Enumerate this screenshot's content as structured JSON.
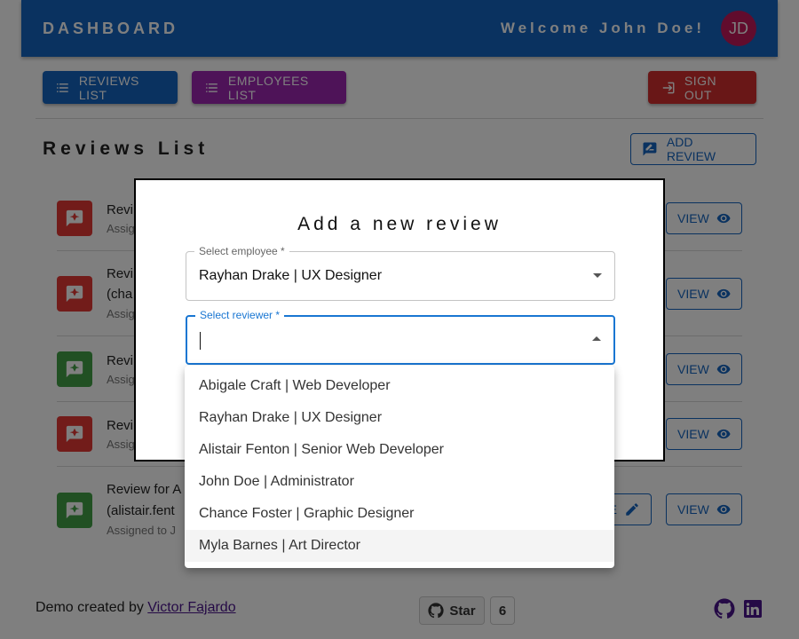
{
  "header": {
    "brand": "DASHBOARD",
    "welcome": "Welcome John Doe!",
    "avatar_initials": "JD"
  },
  "nav": {
    "reviews_list": "REVIEWS LIST",
    "employees_list": "EMPLOYEES LIST",
    "sign_out": "SIGN OUT"
  },
  "reviews": {
    "title": "Reviews List",
    "add_label": "ADD REVIEW",
    "rows": [
      {
        "title": "Revi",
        "subtitle": "Assig",
        "status_color": "#e53935",
        "view_label": "VIEW"
      },
      {
        "title": "Revi",
        "title_line2": "(cha",
        "subtitle": "Assig",
        "status_color": "#e53935",
        "view_label": "VIEW"
      },
      {
        "title": "Revi",
        "subtitle": "Assig",
        "status_color": "#43a047",
        "view_label": "VIEW"
      },
      {
        "title": "Revi",
        "subtitle": "Assig",
        "status_color": "#e53935",
        "view_label": "VIEW"
      },
      {
        "title": "Review for A",
        "title_line2": "(alistair.fent",
        "subtitle": "Assigned to J",
        "status_color": "#43a047",
        "edit_label": "E",
        "view_label": "VIEW"
      }
    ]
  },
  "modal": {
    "title": "Add a new review",
    "employee_field": {
      "label": "Select employee *",
      "value": "Rayhan Drake | UX Designer"
    },
    "reviewer_field": {
      "label": "Select reviewer *",
      "value": ""
    },
    "options": [
      "Abigale Craft | Web Developer",
      "Rayhan Drake | UX Designer",
      "Alistair Fenton | Senior Web Developer",
      "John Doe | Administrator",
      "Chance Foster | Graphic Designer",
      "Myla Barnes | Art Director"
    ]
  },
  "footer": {
    "demo_text": "Demo created by ",
    "author": "Victor Fajardo",
    "star_label": "Star",
    "star_count": "6"
  },
  "colors": {
    "primary": "#1565c0",
    "purple": "#9c27b0",
    "danger": "#d32f2f",
    "success": "#43a047",
    "avatar": "#c2185b"
  },
  "icons": [
    "list-icon",
    "logout-icon",
    "add-review-icon",
    "review-icon",
    "eye-icon",
    "edit-icon",
    "github-icon",
    "linkedin-icon"
  ]
}
